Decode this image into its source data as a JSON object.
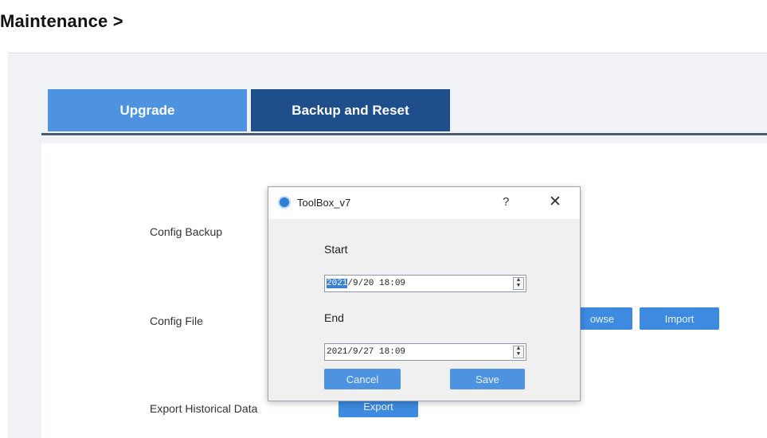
{
  "page": {
    "title": "Maintenance >"
  },
  "tabs": [
    {
      "label": "Upgrade"
    },
    {
      "label": "Backup and Reset"
    }
  ],
  "rows": {
    "config_backup": {
      "label": "Config Backup"
    },
    "config_file": {
      "label": "Config File",
      "browse_label": "owse",
      "import_label": "Import"
    },
    "export_data": {
      "label": "Export Historical Data",
      "export_label": "Export"
    }
  },
  "dialog": {
    "title": "ToolBox_v7",
    "help": "?",
    "close": "✕",
    "start_label": "Start",
    "start_value_selected": "2021",
    "start_value_rest": "/9/20 18:09",
    "end_label": "End",
    "end_value": "2021/9/27 18:09",
    "cancel_label": "Cancel",
    "save_label": "Save"
  },
  "colors": {
    "tab_active": "#1e4e8c",
    "tab_inactive": "#4d93e0",
    "button": "#3d8ae0"
  }
}
